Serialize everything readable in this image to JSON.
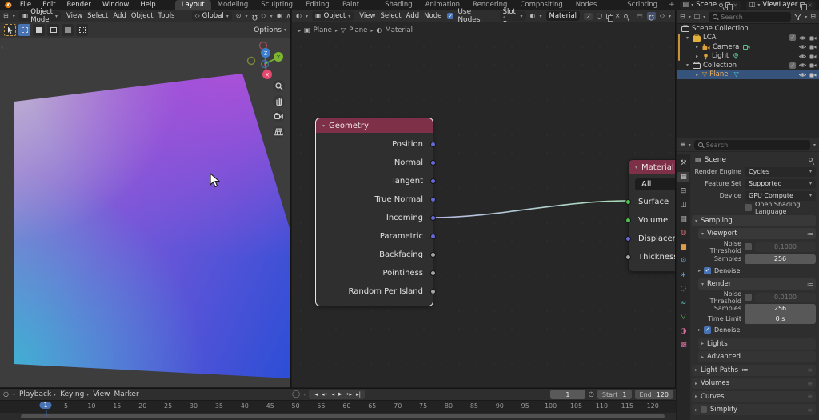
{
  "colors": {
    "accent_blue": "#4772b3",
    "node_header_red": "#7d3048",
    "socket_vector": "#6868d8",
    "socket_shader": "#4fc14f",
    "socket_float": "#a5a5a5",
    "object_orange": "#e0a33c",
    "selection_row_blue": "#36537c",
    "axis_x_red": "#e8486e",
    "axis_y_green": "#7cb530",
    "axis_z_blue": "#3a7fd0",
    "viewport_gradient_corners": [
      "#c9b8d2",
      "#b84fd8",
      "#38bad2",
      "#2a4ed6"
    ]
  },
  "topbar": {
    "menus": [
      "File",
      "Edit",
      "Render",
      "Window",
      "Help"
    ],
    "workspaces": [
      "Layout",
      "Modeling",
      "Sculpting",
      "UV Editing",
      "Texture Paint",
      "Shading",
      "Animation",
      "Rendering",
      "Compositing",
      "Geometry Nodes",
      "Scripting"
    ],
    "active_workspace": "Layout",
    "add_workspace": "+",
    "scene_label": "Scene",
    "viewlayer_label": "ViewLayer"
  },
  "viewport": {
    "mode": "Object Mode",
    "menus": [
      "View",
      "Select",
      "Add",
      "Object",
      "Tools"
    ],
    "orientation": "Global",
    "options_label": "Options",
    "gizmo": {
      "x": "X",
      "y": "Y",
      "z": "Z"
    }
  },
  "shader_editor": {
    "type_label": "Object",
    "menus": [
      "View",
      "Select",
      "Add",
      "Node"
    ],
    "use_nodes_label": "Use Nodes",
    "slot_label": "Slot 1",
    "material_name": "Material",
    "users_count": "2",
    "breadcrumb": [
      "Plane",
      "Plane",
      "Material"
    ]
  },
  "geometry_node": {
    "title": "Geometry",
    "outputs": [
      {
        "name": "Position",
        "type": "vector"
      },
      {
        "name": "Normal",
        "type": "vector"
      },
      {
        "name": "Tangent",
        "type": "vector"
      },
      {
        "name": "True Normal",
        "type": "vector"
      },
      {
        "name": "Incoming",
        "type": "vector",
        "connected": true
      },
      {
        "name": "Parametric",
        "type": "vector"
      },
      {
        "name": "Backfacing",
        "type": "float"
      },
      {
        "name": "Pointiness",
        "type": "float"
      },
      {
        "name": "Random Per Island",
        "type": "float"
      }
    ]
  },
  "material_node": {
    "title": "Material",
    "target": "All",
    "inputs": [
      {
        "name": "Surface",
        "type": "shader",
        "connected": true
      },
      {
        "name": "Volume",
        "type": "shader"
      },
      {
        "name": "Displacement",
        "type": "vector"
      },
      {
        "name": "Thickness",
        "type": "float"
      }
    ]
  },
  "outliner": {
    "search_placeholder": "Search",
    "rows": [
      {
        "label": "Scene Collection",
        "type": "collection"
      },
      {
        "label": "LCA",
        "type": "collection"
      },
      {
        "label": "Camera",
        "type": "camera"
      },
      {
        "label": "Light",
        "type": "light"
      },
      {
        "label": "Collection",
        "type": "collection"
      },
      {
        "label": "Plane",
        "type": "mesh",
        "selected": true
      }
    ]
  },
  "property_tabs": [
    {
      "name": "tool",
      "glyph": "⚒",
      "css": "color:#bdbdbd"
    },
    {
      "name": "render",
      "glyph": "▦",
      "css": "color:#d2d2d2",
      "active": true
    },
    {
      "name": "output",
      "glyph": "⊟",
      "css": "color:#bdbdbd"
    },
    {
      "name": "view-layer",
      "glyph": "◫",
      "css": "color:#bdbdbd"
    },
    {
      "name": "scene",
      "glyph": "▤",
      "css": "color:#bdbdbd"
    },
    {
      "name": "world",
      "glyph": "◍",
      "css": "color:#d66a6a"
    },
    {
      "name": "object",
      "glyph": "■",
      "css": "color:#e09b4a"
    },
    {
      "name": "modifiers",
      "glyph": "⚙",
      "css": "color:#6aa2d6"
    },
    {
      "name": "particles",
      "glyph": "∗",
      "css": "color:#6aa2d6"
    },
    {
      "name": "physics",
      "glyph": "◌",
      "css": "color:#6aa2d6"
    },
    {
      "name": "constraints",
      "glyph": "≈",
      "css": "color:#6ad6d6"
    },
    {
      "name": "object-data",
      "glyph": "▽",
      "css": "color:#6ad66a"
    },
    {
      "name": "material",
      "glyph": "◑",
      "css": "color:#d66a9b"
    },
    {
      "name": "texture",
      "glyph": "▩",
      "css": "color:#d66a9b"
    }
  ],
  "properties": {
    "search_placeholder": "Search",
    "breadcrumb": "Scene",
    "render_engine_label": "Render Engine",
    "render_engine": "Cycles",
    "feature_set_label": "Feature Set",
    "feature_set": "Supported",
    "device_label": "Device",
    "device": "GPU Compute",
    "osl_label": "Open Shading Language",
    "sampling_label": "Sampling",
    "viewport_label": "Viewport",
    "noise_threshold_label": "Noise Threshold",
    "viewport_noise_threshold": "0.1000",
    "samples_label": "Samples",
    "viewport_samples": "256",
    "denoise_label": "Denoise",
    "render_label": "Render",
    "render_noise_threshold": "0.0100",
    "render_samples": "256",
    "time_limit_label": "Time Limit",
    "time_limit": "0 s",
    "panels": [
      "Lights",
      "Advanced",
      "Light Paths",
      "Volumes",
      "Curves",
      "Simplify"
    ]
  },
  "timeline": {
    "menus": [
      "Playback",
      "Keying",
      "View",
      "Marker"
    ],
    "current_frame": "1",
    "start_label": "Start",
    "start_value": "1",
    "end_label": "End",
    "end_value": "120",
    "ticks": [
      "1",
      "5",
      "10",
      "15",
      "20",
      "25",
      "30",
      "35",
      "40",
      "45",
      "50",
      "55",
      "60",
      "65",
      "70",
      "75",
      "80",
      "85",
      "90",
      "95",
      "100",
      "105",
      "110",
      "115",
      "120"
    ]
  }
}
